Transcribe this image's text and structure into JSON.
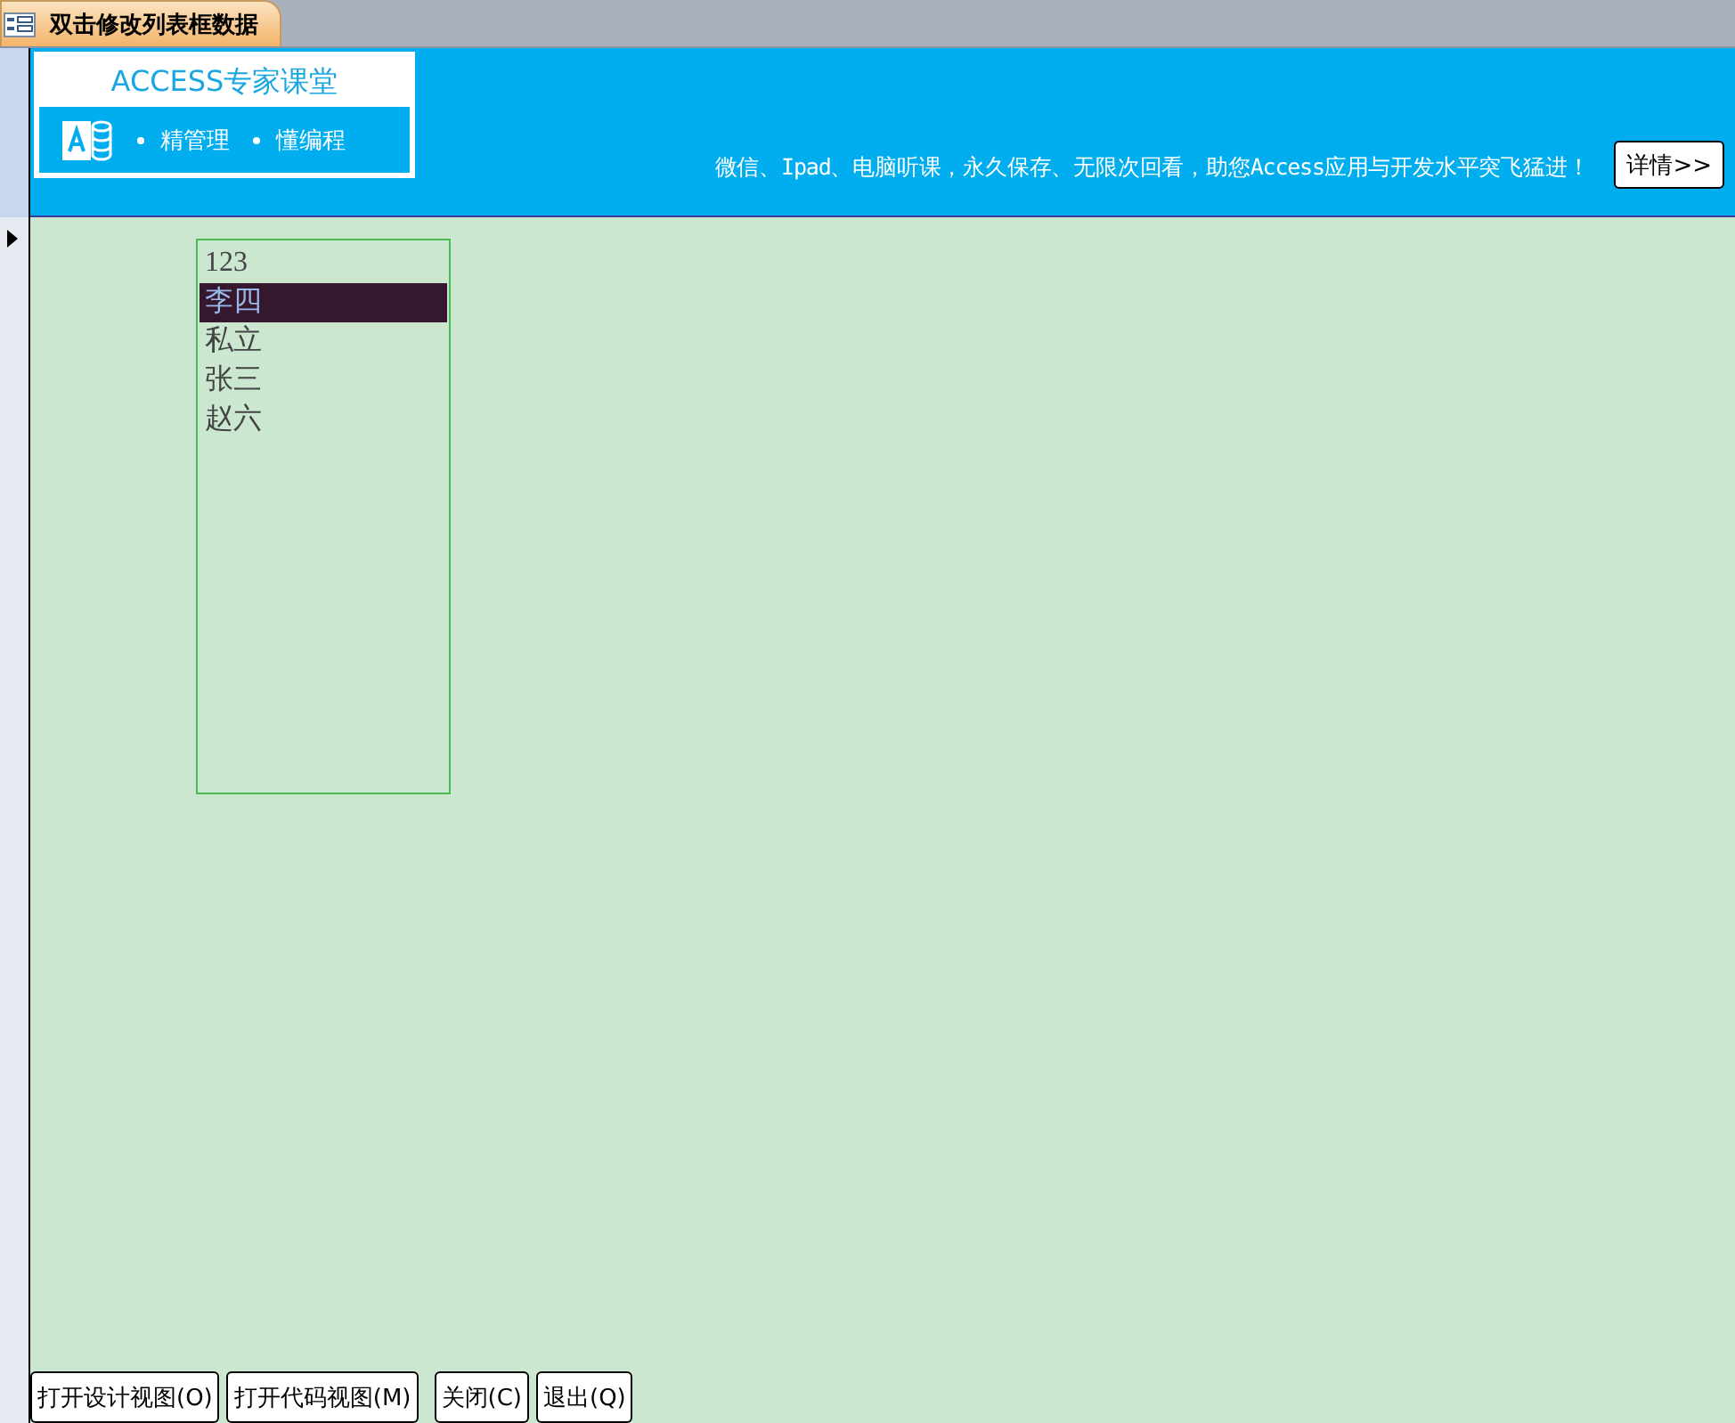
{
  "tab": {
    "title": "双击修改列表框数据"
  },
  "banner": {
    "brand": "ACCESS专家课堂",
    "slogans": [
      "精管理",
      "懂编程"
    ],
    "promo": "微信、Ipad、电脑听课，永久保存、无限次回看，助您Access应用与开发水平突飞猛进！",
    "details_button": "详情>>"
  },
  "listbox": {
    "items": [
      {
        "text": "123",
        "selected": false
      },
      {
        "text": "李四",
        "selected": true
      },
      {
        "text": "私立",
        "selected": false
      },
      {
        "text": "张三",
        "selected": false
      },
      {
        "text": "赵六",
        "selected": false
      }
    ]
  },
  "buttons": [
    "打开设计视图(O)",
    "打开代码视图(M)",
    "关闭(C)",
    "退出(Q)"
  ]
}
